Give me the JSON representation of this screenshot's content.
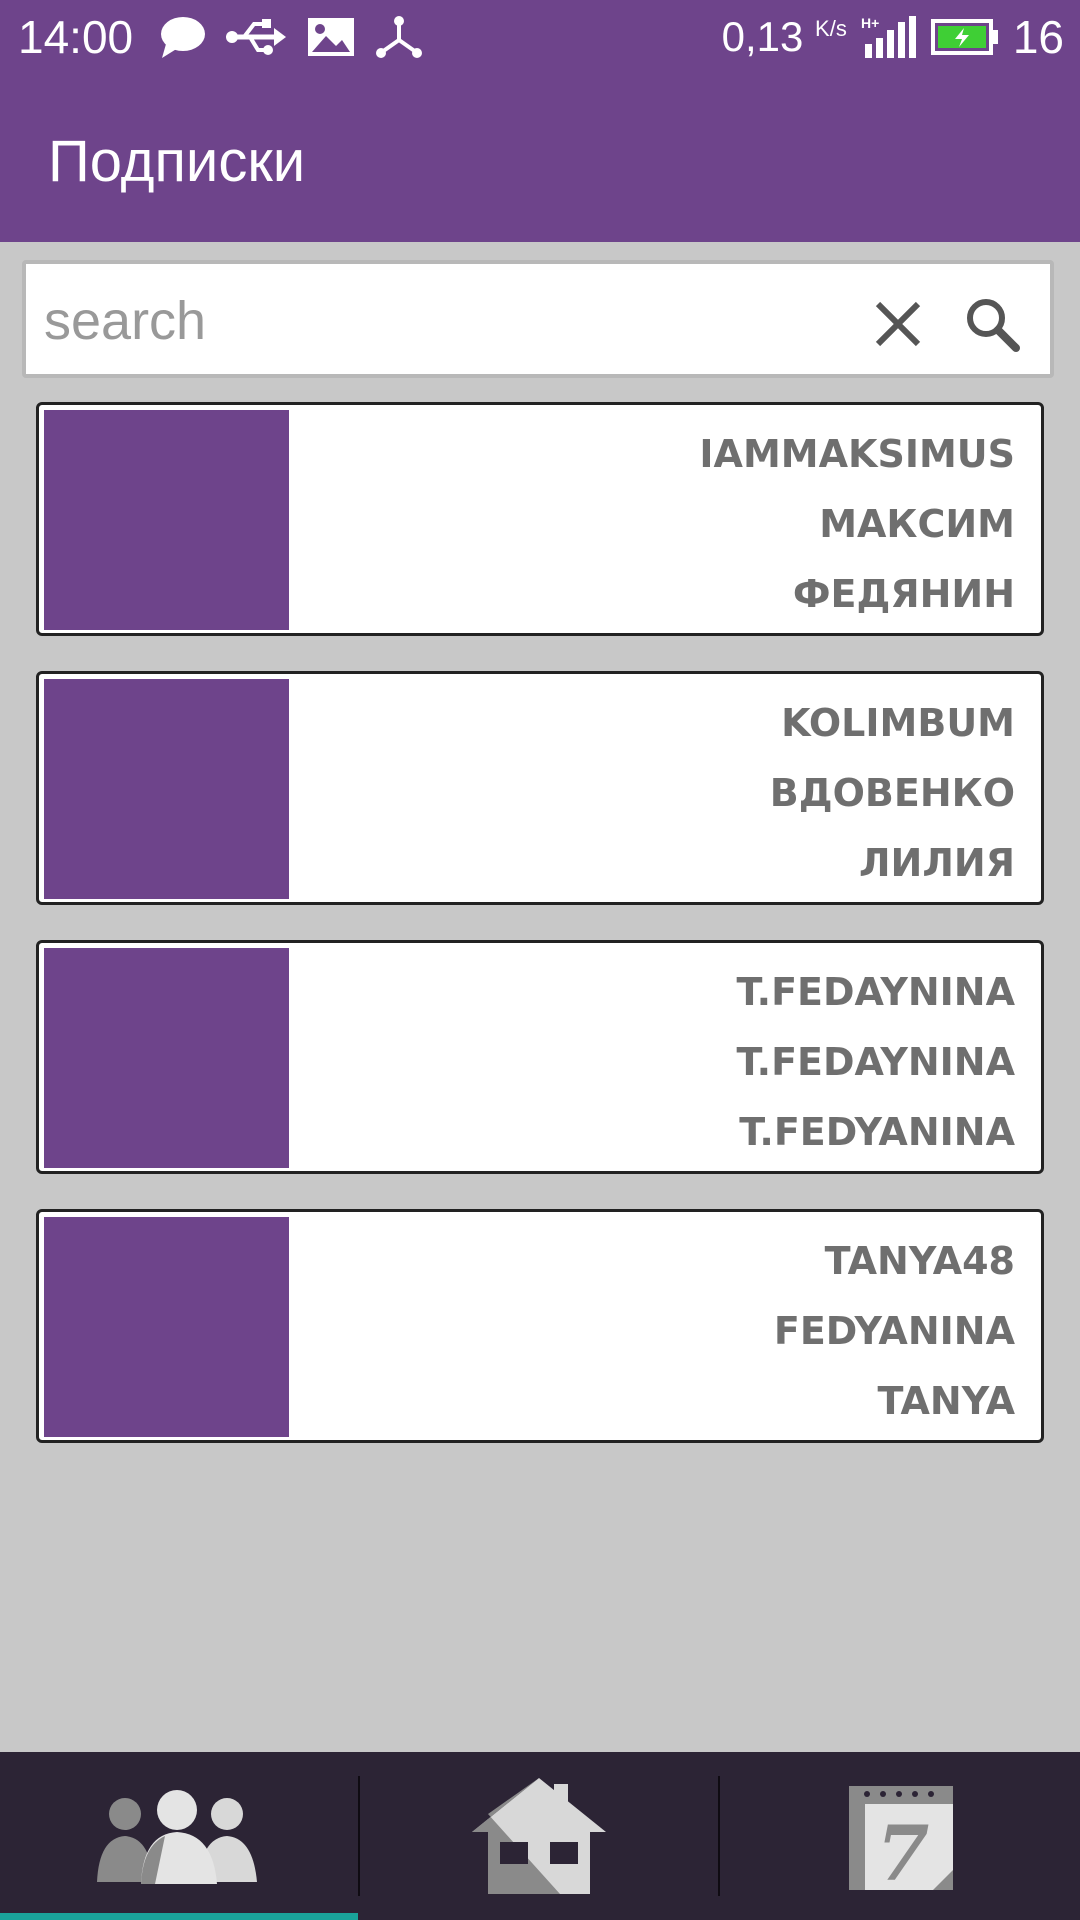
{
  "status_bar": {
    "time": "14:00",
    "net_speed": "0,13",
    "net_unit": "K/s",
    "battery": "16",
    "icons": [
      "chat-icon",
      "usb-icon",
      "image-icon",
      "share-node-icon",
      "hplus-signal-icon",
      "battery-charging-icon"
    ]
  },
  "app_bar": {
    "title": "Подписки"
  },
  "search": {
    "placeholder": "search",
    "value": ""
  },
  "subscriptions": [
    {
      "lines": [
        "IAMMAKSIMUS",
        "МАКСИМ",
        "ФЕДЯНИН"
      ]
    },
    {
      "lines": [
        "KOLIMBUM",
        "ВДОВЕНКО",
        "ЛИЛИЯ"
      ]
    },
    {
      "lines": [
        "T.FEDAYNINA",
        "T.FEDAYNINA",
        "T.FEDYANINA"
      ]
    },
    {
      "lines": [
        "TANYA48",
        "FEDYANINA",
        "TANYA"
      ]
    }
  ],
  "colors": {
    "accent": "#6e448b",
    "nav_bg": "#2c2435",
    "indicator": "#1aa39a",
    "page_bg": "#c8c8c8"
  },
  "bottom_nav": {
    "items": [
      {
        "icon": "people-icon",
        "active": true
      },
      {
        "icon": "home-icon",
        "active": false
      },
      {
        "icon": "calendar-icon",
        "label": "7",
        "active": false
      }
    ]
  }
}
